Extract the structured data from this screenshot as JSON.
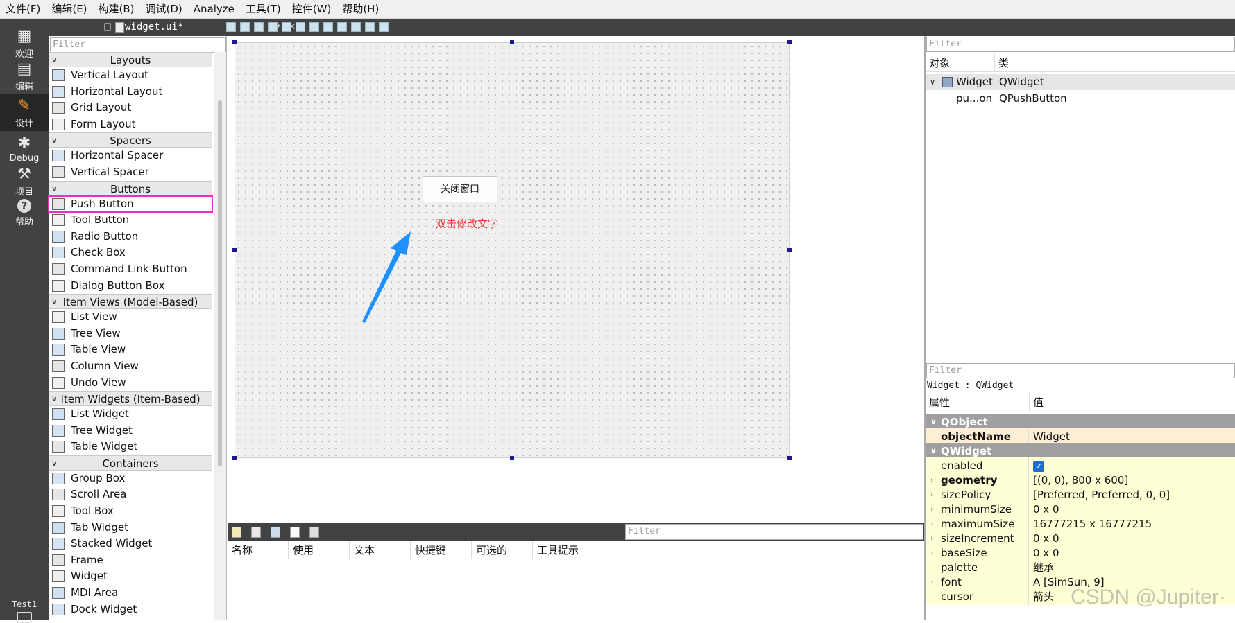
{
  "menu": [
    "文件(F)",
    "编辑(E)",
    "构建(B)",
    "调试(D)",
    "Analyze",
    "工具(T)",
    "控件(W)",
    "帮助(H)"
  ],
  "modes": [
    {
      "label": "欢迎",
      "icon": "grid-icon"
    },
    {
      "label": "编辑",
      "icon": "document-icon"
    },
    {
      "label": "设计",
      "icon": "pencil-icon"
    },
    {
      "label": "Debug",
      "icon": "bug-icon"
    },
    {
      "label": "项目",
      "icon": "wrench-icon"
    },
    {
      "label": "帮助",
      "icon": "help-icon"
    }
  ],
  "target": "Test1",
  "document": {
    "name": "widget.ui*"
  },
  "widget_box": {
    "filter_placeholder": "Filter",
    "categories": [
      {
        "name": "Layouts",
        "items": [
          "Vertical Layout",
          "Horizontal Layout",
          "Grid Layout",
          "Form Layout"
        ]
      },
      {
        "name": "Spacers",
        "items": [
          "Horizontal Spacer",
          "Vertical Spacer"
        ]
      },
      {
        "name": "Buttons",
        "items": [
          "Push Button",
          "Tool Button",
          "Radio Button",
          "Check Box",
          "Command Link Button",
          "Dialog Button Box"
        ]
      },
      {
        "name": "Item Views (Model-Based)",
        "items": [
          "List View",
          "Tree View",
          "Table View",
          "Column View",
          "Undo View"
        ]
      },
      {
        "name": "Item Widgets (Item-Based)",
        "items": [
          "List Widget",
          "Tree Widget",
          "Table Widget"
        ]
      },
      {
        "name": "Containers",
        "items": [
          "Group Box",
          "Scroll Area",
          "Tool Box",
          "Tab Widget",
          "Stacked Widget",
          "Frame",
          "Widget",
          "MDI Area",
          "Dock Widget"
        ]
      }
    ],
    "highlighted_item": "Push Button"
  },
  "form": {
    "button_text": "关闭窗口",
    "annotation": "双击修改文字",
    "annotation_color": "#e33333",
    "arrow_color": "#1e90ff"
  },
  "action_editor": {
    "filter_placeholder": "Filter",
    "columns": [
      "名称",
      "使用",
      "文本",
      "快捷键",
      "可选的",
      "工具提示"
    ]
  },
  "object_inspector": {
    "filter_placeholder": "Filter",
    "columns": [
      "对象",
      "类"
    ],
    "rows": [
      {
        "object": "Widget",
        "class": "QWidget"
      },
      {
        "object": "pu...on",
        "class": "QPushButton"
      }
    ]
  },
  "property_editor": {
    "filter_placeholder": "Filter",
    "title": "Widget : QWidget",
    "columns": [
      "属性",
      "值"
    ],
    "rows": [
      {
        "type": "group",
        "name": "QObject"
      },
      {
        "type": "prop",
        "name": "objectName",
        "value": "Widget",
        "bold": true,
        "bg": "orange"
      },
      {
        "type": "group",
        "name": "QWidget"
      },
      {
        "type": "prop",
        "name": "enabled",
        "value": "",
        "checkbox": true,
        "bg": "yellow"
      },
      {
        "type": "prop",
        "name": "geometry",
        "value": "[(0, 0), 800 x 600]",
        "bold": true,
        "expandable": true,
        "bg": "yellow"
      },
      {
        "type": "prop",
        "name": "sizePolicy",
        "value": "[Preferred, Preferred, 0, 0]",
        "expandable": true,
        "bg": "yellow"
      },
      {
        "type": "prop",
        "name": "minimumSize",
        "value": "0 x 0",
        "expandable": true,
        "bg": "yellow"
      },
      {
        "type": "prop",
        "name": "maximumSize",
        "value": "16777215 x 16777215",
        "expandable": true,
        "bg": "yellow"
      },
      {
        "type": "prop",
        "name": "sizeIncrement",
        "value": "0 x 0",
        "expandable": true,
        "bg": "yellow"
      },
      {
        "type": "prop",
        "name": "baseSize",
        "value": "0 x 0",
        "expandable": true,
        "bg": "yellow"
      },
      {
        "type": "prop",
        "name": "palette",
        "value": "继承",
        "bg": "yellow"
      },
      {
        "type": "prop",
        "name": "font",
        "value": "A  [SimSun, 9]",
        "expandable": true,
        "bg": "yellow"
      },
      {
        "type": "prop",
        "name": "cursor",
        "value": "箭头",
        "bg": "yellow"
      }
    ]
  },
  "watermark": "CSDN @Jupiter·"
}
